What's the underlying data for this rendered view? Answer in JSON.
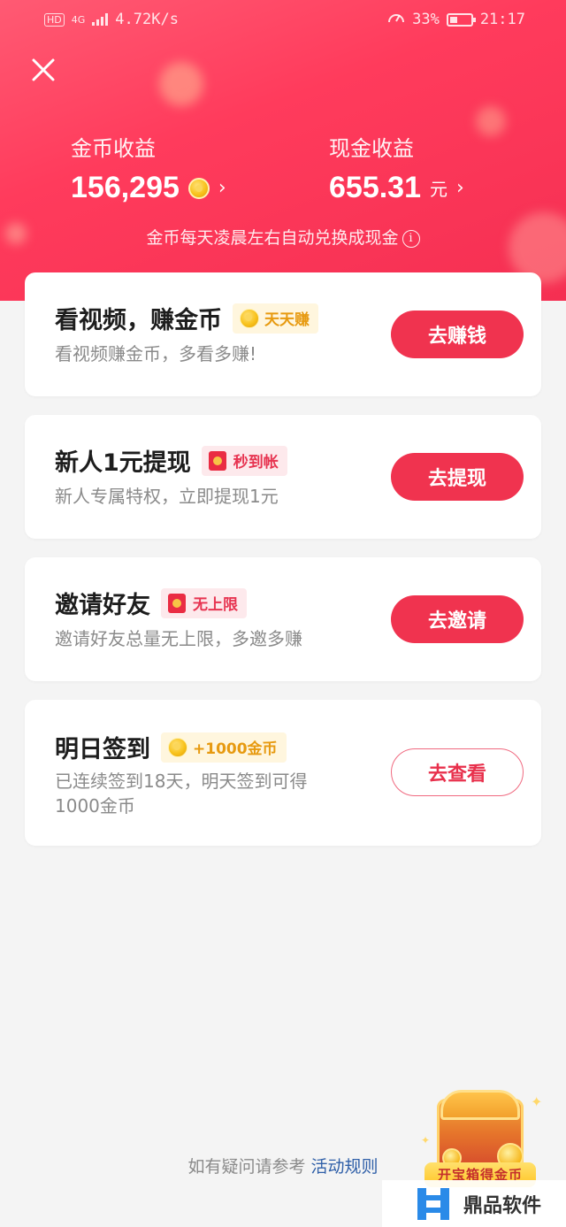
{
  "status_bar": {
    "hd": "HD",
    "network": "4G",
    "speed": "4.72K/s",
    "battery": "33%",
    "time": "21:17"
  },
  "header": {
    "coin_label": "金币收益",
    "coin_value": "156,295",
    "cash_label": "现金收益",
    "cash_value": "655.31",
    "cash_unit": "元",
    "hint": "金币每天凌晨左右自动兑换成现金"
  },
  "tasks": [
    {
      "title": "看视频，赚金币",
      "tag": "天天赚",
      "tag_icon": "coin-icon",
      "desc": "看视频赚金币，多看多赚!",
      "button": "去赚钱"
    },
    {
      "title": "新人1元提现",
      "tag": "秒到帐",
      "tag_icon": "red-envelope-icon",
      "desc": "新人专属特权，立即提现1元",
      "button": "去提现"
    },
    {
      "title": "邀请好友",
      "tag": "无上限",
      "tag_icon": "red-envelope-icon",
      "desc": "邀请好友总量无上限，多邀多赚",
      "button": "去邀请"
    },
    {
      "title": "明日签到",
      "tag": "+1000金币",
      "tag_icon": "coin-icon",
      "desc": "已连续签到18天，明天签到可得1000金币",
      "button": "去查看"
    }
  ],
  "footer": {
    "question_text": "如有疑问请参考",
    "rules_link": "活动规则"
  },
  "treasure": {
    "label": "开宝箱得金币"
  },
  "watermark": {
    "text": "鼎品软件"
  },
  "colors": {
    "accent": "#f0334f",
    "header_gradient_start": "#ff5a73",
    "header_gradient_end": "#f52f52",
    "coin_gold": "#f8c21c",
    "link_blue": "#2f5fa8"
  }
}
